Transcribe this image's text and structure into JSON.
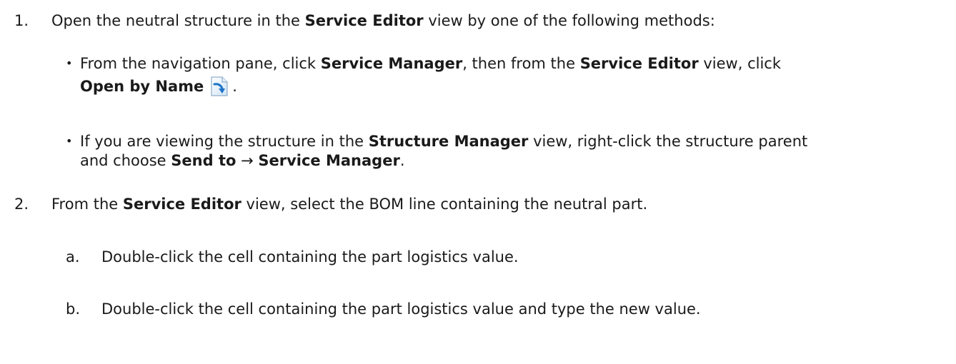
{
  "steps": [
    {
      "number": "1.",
      "text": {
        "a": "Open the neutral structure in the ",
        "b": "Service Editor",
        "c": " view by one of the following methods:"
      },
      "bullets": [
        {
          "l1a": "From the navigation pane, click ",
          "l1b": "Service Manager",
          "l1c": ", then from the ",
          "l1d": "Service Editor",
          "l1e": " view, click",
          "l2a": "Open by Name",
          "l2b": ".",
          "icon": "open-by-name-icon"
        },
        {
          "l1a": "If you are viewing the structure in the ",
          "l1b": "Structure Manager",
          "l1c": " view, right-click the structure parent",
          "l2a": "and choose ",
          "l2b": "Send to",
          "l2c": " → ",
          "l2d": "Service Manager",
          "l2e": "."
        }
      ]
    },
    {
      "number": "2.",
      "text": {
        "a": "From the ",
        "b": "Service Editor",
        "c": " view, select the BOM line containing the neutral part."
      },
      "substeps": [
        {
          "label": "a.",
          "text": "Double-click the cell containing the part logistics value."
        },
        {
          "label": "b.",
          "text": "Double-click the cell containing the part logistics value and type the new value."
        }
      ]
    }
  ]
}
